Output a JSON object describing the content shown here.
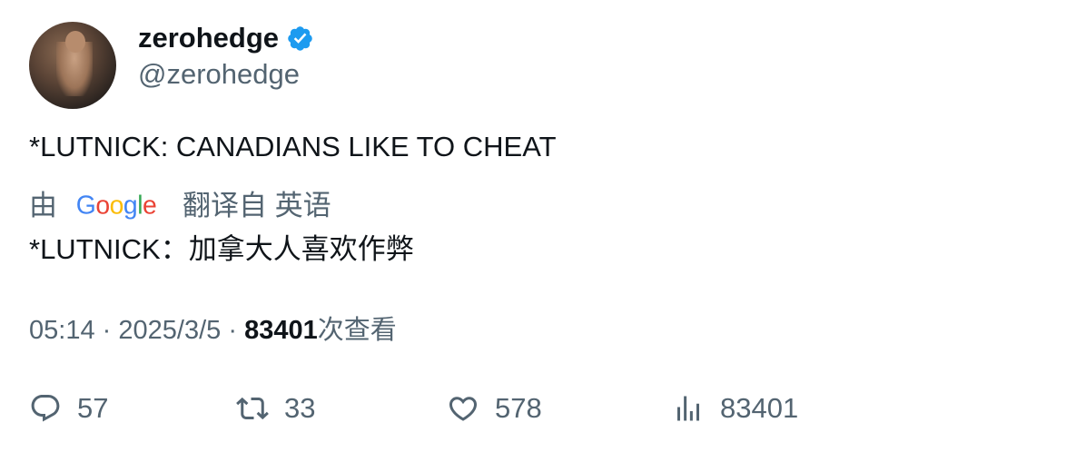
{
  "author": {
    "display_name": "zerohedge",
    "handle": "@zerohedge",
    "verified": true,
    "verified_color": "#1d9bf0"
  },
  "tweet": {
    "text": "*LUTNICK: CANADIANS LIKE TO CHEAT"
  },
  "translation": {
    "by_label": "由",
    "provider": "Google",
    "from_label": "翻译自 英语",
    "text": "*LUTNICK：加拿大人喜欢作弊"
  },
  "meta": {
    "time": "05:14",
    "separator": "·",
    "date": "2025/3/5",
    "views_count": "83401",
    "views_label": "次查看"
  },
  "actions": {
    "replies": "57",
    "retweets": "33",
    "likes": "578",
    "views": "83401"
  },
  "icons": {
    "reply": "reply-icon",
    "retweet": "retweet-icon",
    "like": "heart-icon",
    "views": "analytics-icon"
  }
}
